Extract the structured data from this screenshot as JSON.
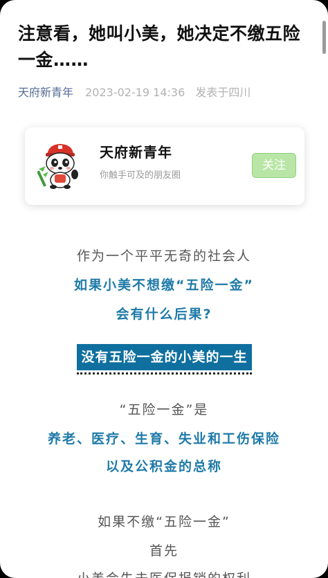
{
  "article": {
    "title": "注意看，她叫小美，她决定不缴五险一金……",
    "author": "天府新青年",
    "datetime": "2023-02-19 14:36",
    "location": "发表于四川"
  },
  "account_card": {
    "name": "天府新青年",
    "subtitle": "你触手可及的朋友圈",
    "follow_label": "关注",
    "avatar_icon": "panda-mascot-icon"
  },
  "body": {
    "line1": "作为一个平平无奇的社会人",
    "line2": "如果小美不想缴“五险一金”",
    "line3": "会有什么后果?",
    "section_tag": "没有五险一金的小美的一生",
    "line4": "“五险一金”是",
    "line5": "养老、医疗、生育、失业和工伤保险",
    "line6": "以及公积金的总称",
    "line7": "如果不缴“五险一金”",
    "line8": "首先",
    "line9": "小美会失去医保报销的权利"
  },
  "colors": {
    "link_author": "#576b95",
    "accent_blue": "#1e7aa8",
    "tag_bg": "#0f6f9f",
    "follow_green": "#b9e6a6"
  }
}
